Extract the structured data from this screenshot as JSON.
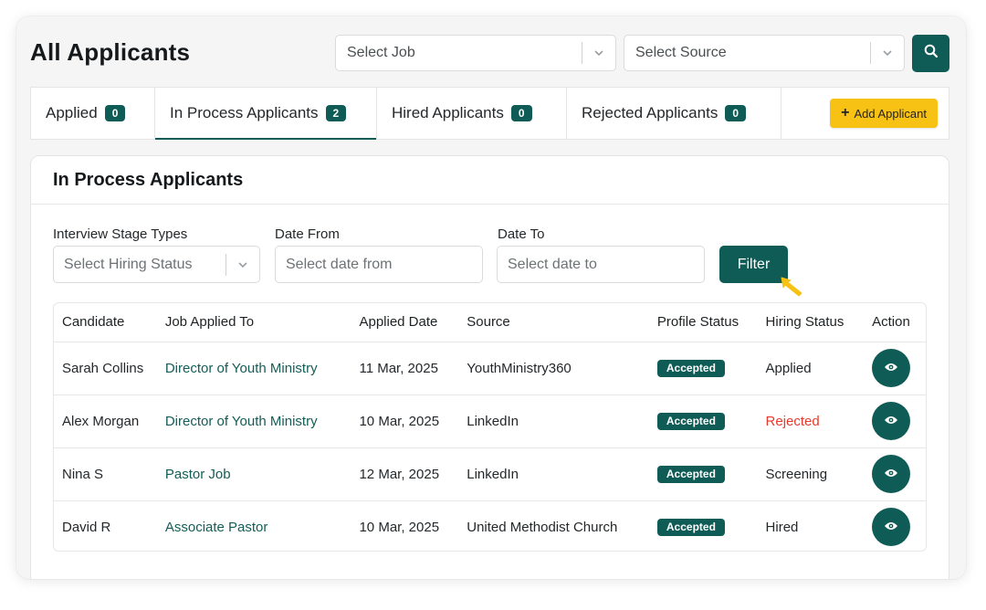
{
  "header": {
    "title": "All Applicants",
    "select_job_placeholder": "Select Job",
    "select_source_placeholder": "Select Source"
  },
  "tabs": [
    {
      "label": "Applied",
      "count": "0",
      "active": false
    },
    {
      "label": "In Process Applicants",
      "count": "2",
      "active": true
    },
    {
      "label": "Hired Applicants",
      "count": "0",
      "active": false
    },
    {
      "label": "Rejected Applicants",
      "count": "0",
      "active": false
    }
  ],
  "add_button_label": "Add Applicant",
  "card": {
    "title": "In Process Applicants",
    "filters": {
      "stage_label": "Interview Stage Types",
      "stage_placeholder": "Select Hiring Status",
      "from_label": "Date From",
      "from_placeholder": "Select date from",
      "to_label": "Date To",
      "to_placeholder": "Select date to",
      "filter_button": "Filter"
    }
  },
  "table": {
    "columns": [
      "Candidate",
      "Job Applied To",
      "Applied Date",
      "Source",
      "Profile Status",
      "Hiring Status",
      "Action"
    ],
    "rows": [
      {
        "candidate": "Sarah Collins",
        "job": "Director of Youth Ministry",
        "date": "11 Mar, 2025",
        "source": "YouthMinistry360",
        "profile_status": "Accepted",
        "hiring_status": "Applied"
      },
      {
        "candidate": "Alex Morgan",
        "job": "Director of Youth Ministry",
        "date": "10 Mar, 2025",
        "source": "LinkedIn",
        "profile_status": "Accepted",
        "hiring_status": "Rejected"
      },
      {
        "candidate": "Nina S",
        "job": "Pastor Job",
        "date": "12 Mar, 2025",
        "source": "LinkedIn",
        "profile_status": "Accepted",
        "hiring_status": "Screening"
      },
      {
        "candidate": "David R",
        "job": "Associate Pastor",
        "date": "10 Mar, 2025",
        "source": "United Methodist Church",
        "profile_status": "Accepted",
        "hiring_status": "Hired"
      }
    ]
  },
  "colors": {
    "primary": "#0f5c57",
    "accent_yellow": "#f8c215",
    "rejected_red": "#e8392d"
  },
  "icons": {
    "search": "search-icon",
    "chevron": "chevron-down-icon",
    "plus": "plus-icon",
    "view": "eye-icon",
    "cursor": "pointer-cursor-icon"
  }
}
